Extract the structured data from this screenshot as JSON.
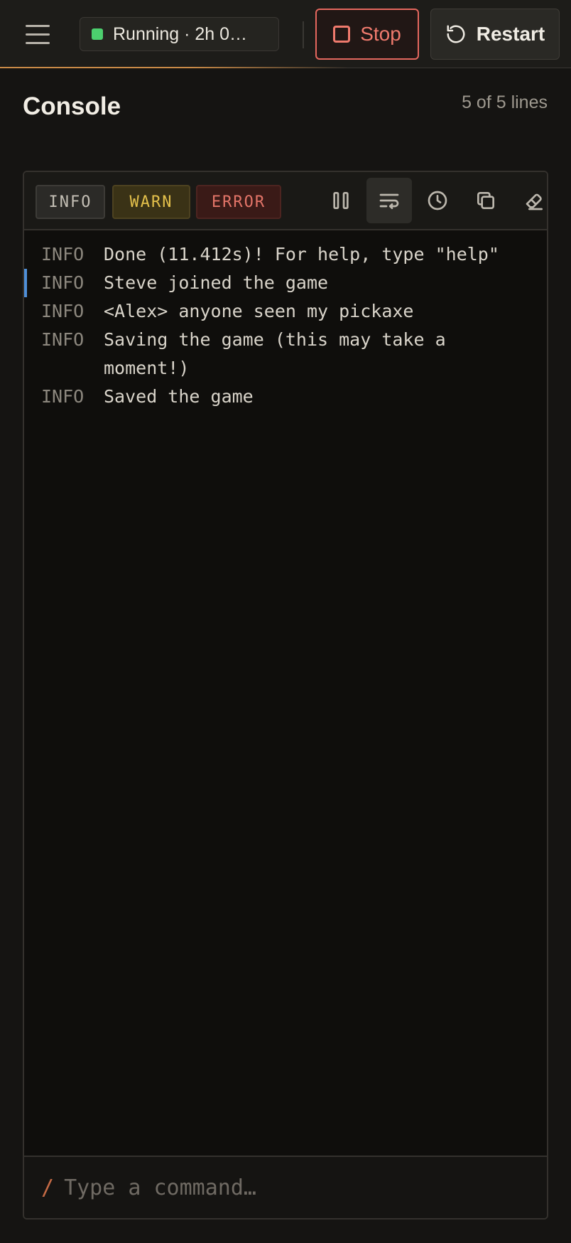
{
  "header": {
    "menu_icon": "hamburger-icon",
    "status": {
      "text": "Running · 2h 0…",
      "color": "#4ccf6e"
    },
    "stop_label": "Stop",
    "restart_label": "Restart"
  },
  "console": {
    "title": "Console",
    "line_count": "5 of 5 lines",
    "filters": [
      {
        "label": "INFO",
        "color": "#c4bfb5"
      },
      {
        "label": "WARN",
        "color": "#e3c04b"
      },
      {
        "label": "ERROR",
        "color": "#e27468"
      }
    ],
    "tools": [
      "pause-icon",
      "wrap-lines-icon",
      "clock-icon",
      "copy-icon",
      "eraser-icon"
    ],
    "active_tool": "wrap-lines-icon",
    "lines": [
      {
        "level": "INFO",
        "message": "Done (11.412s)! For help, type \"help\""
      },
      {
        "level": "INFO",
        "message": "Steve joined the game",
        "marked": true
      },
      {
        "level": "INFO",
        "message": "<Alex> anyone seen my pickaxe"
      },
      {
        "level": "INFO",
        "message": "Saving the game (this may take a moment!)"
      },
      {
        "level": "INFO",
        "message": "Saved the game"
      }
    ],
    "command": {
      "prefix": "/",
      "placeholder": "Type a command…",
      "value": ""
    }
  },
  "colors": {
    "accent": "#c98a47",
    "stop": "#e5675e",
    "marker": "#4f8fd8"
  }
}
